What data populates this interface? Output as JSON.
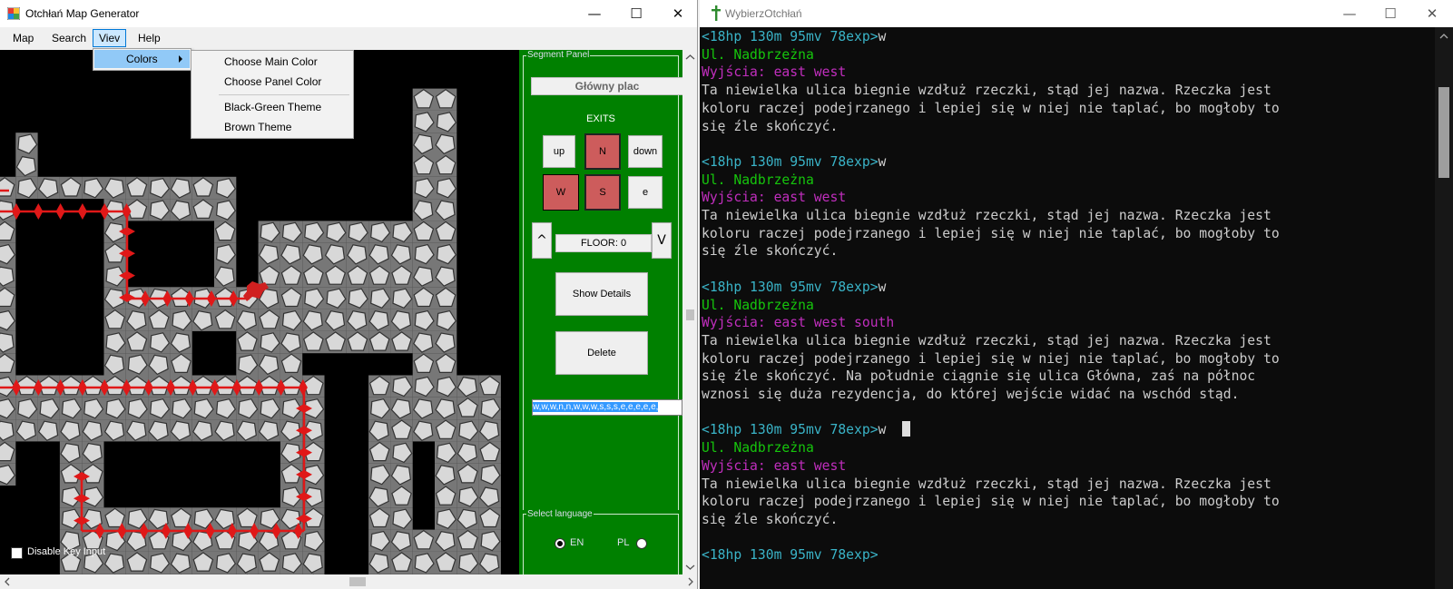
{
  "left_window": {
    "title": "Otchłań Map Generator",
    "controls": {
      "minimize": "—",
      "maximize": "☐",
      "close": "✕"
    },
    "menu": [
      "Map",
      "Search",
      "Viev",
      "Help"
    ],
    "view_submenu": {
      "colors": "Colors"
    },
    "colors_submenu": [
      "Choose Main Color",
      "Choose Panel Color",
      "Black-Green Theme",
      "Brown Theme"
    ],
    "disable_key_input": {
      "label": "Disable Key Input",
      "checked": false
    },
    "segment_panel": {
      "title": "Segment Panel",
      "segment_name": "Główny plac",
      "exits_label": "EXITS",
      "exits": {
        "up": "up",
        "north": "N",
        "down": "down",
        "west": "W",
        "south": "S",
        "east": "e"
      },
      "active_exits": [
        "N",
        "W",
        "S"
      ],
      "floor_up": "^",
      "floor_down": "V",
      "floor_label": "FLOOR: 0",
      "show_details": "Show Details",
      "delete": "Delete",
      "path_text": "w,w,w,n,n,w,w,w,s,s,s,e,e,e,e,e,",
      "language": {
        "title": "Select language",
        "en": "EN",
        "pl": "PL",
        "selected": "EN"
      }
    },
    "colors": {
      "panel_green": "#008000",
      "exit_active": "#cd5c5c",
      "map_bg": "#000000",
      "path_red": "#e01818"
    }
  },
  "right_window": {
    "title": "WybierzOtchłań",
    "controls": {
      "minimize": "—",
      "maximize": "☐",
      "close": "✕"
    },
    "lines": [
      {
        "segments": [
          {
            "t": "<18hp 130m 95mv 78exp>",
            "c": "prompt"
          },
          {
            "t": "w",
            "c": "cmd"
          }
        ]
      },
      {
        "segments": [
          {
            "t": "Ul. Nadbrzeżna",
            "c": "room"
          }
        ]
      },
      {
        "segments": [
          {
            "t": "Wyjścia: east west",
            "c": "exits"
          }
        ]
      },
      {
        "segments": [
          {
            "t": "Ta niewielka ulica biegnie wzdłuż rzeczki, stąd jej nazwa. Rzeczka jest",
            "c": "desc"
          }
        ]
      },
      {
        "segments": [
          {
            "t": "koloru raczej podejrzanego i lepiej się w niej nie taplać, bo mogłoby to",
            "c": "desc"
          }
        ]
      },
      {
        "segments": [
          {
            "t": "się źle skończyć.",
            "c": "desc"
          }
        ]
      },
      {
        "segments": []
      },
      {
        "segments": [
          {
            "t": "<18hp 130m 95mv 78exp>",
            "c": "prompt"
          },
          {
            "t": "w",
            "c": "cmd"
          }
        ]
      },
      {
        "segments": [
          {
            "t": "Ul. Nadbrzeżna",
            "c": "room"
          }
        ]
      },
      {
        "segments": [
          {
            "t": "Wyjścia: east west",
            "c": "exits"
          }
        ]
      },
      {
        "segments": [
          {
            "t": "Ta niewielka ulica biegnie wzdłuż rzeczki, stąd jej nazwa. Rzeczka jest",
            "c": "desc"
          }
        ]
      },
      {
        "segments": [
          {
            "t": "koloru raczej podejrzanego i lepiej się w niej nie taplać, bo mogłoby to",
            "c": "desc"
          }
        ]
      },
      {
        "segments": [
          {
            "t": "się źle skończyć.",
            "c": "desc"
          }
        ]
      },
      {
        "segments": []
      },
      {
        "segments": [
          {
            "t": "<18hp 130m 95mv 78exp>",
            "c": "prompt"
          },
          {
            "t": "w",
            "c": "cmd"
          }
        ]
      },
      {
        "segments": [
          {
            "t": "Ul. Nadbrzeżna",
            "c": "room"
          }
        ]
      },
      {
        "segments": [
          {
            "t": "Wyjścia: east west south",
            "c": "exits"
          }
        ]
      },
      {
        "segments": [
          {
            "t": "Ta niewielka ulica biegnie wzdłuż rzeczki, stąd jej nazwa. Rzeczka jest",
            "c": "desc"
          }
        ]
      },
      {
        "segments": [
          {
            "t": "koloru raczej podejrzanego i lepiej się w niej nie taplać, bo mogłoby to",
            "c": "desc"
          }
        ]
      },
      {
        "segments": [
          {
            "t": "się źle skończyć. Na południe ciągnie się ulica Główna, zaś na północ",
            "c": "desc"
          }
        ]
      },
      {
        "segments": [
          {
            "t": "wznosi się duża rezydencja, do której wejście widać na wschód stąd.",
            "c": "desc"
          }
        ]
      },
      {
        "segments": []
      },
      {
        "segments": [
          {
            "t": "<18hp 130m 95mv 78exp>",
            "c": "prompt"
          },
          {
            "t": "w",
            "c": "cmd"
          }
        ],
        "cursor": true
      },
      {
        "segments": [
          {
            "t": "Ul. Nadbrzeżna",
            "c": "room"
          }
        ]
      },
      {
        "segments": [
          {
            "t": "Wyjścia: east west",
            "c": "exits"
          }
        ]
      },
      {
        "segments": [
          {
            "t": "Ta niewielka ulica biegnie wzdłuż rzeczki, stąd jej nazwa. Rzeczka jest",
            "c": "desc"
          }
        ]
      },
      {
        "segments": [
          {
            "t": "koloru raczej podejrzanego i lepiej się w niej nie taplać, bo mogłoby to",
            "c": "desc"
          }
        ]
      },
      {
        "segments": [
          {
            "t": "się źle skończyć.",
            "c": "desc"
          }
        ]
      },
      {
        "segments": []
      },
      {
        "segments": [
          {
            "t": "<18hp 130m 95mv 78exp>",
            "c": "prompt"
          }
        ]
      }
    ],
    "colors": {
      "prompt": "#3ab4c8",
      "room": "#16c60c",
      "exits": "#c02ebd",
      "desc": "#cccccc",
      "bg": "#0c0c0c"
    }
  }
}
